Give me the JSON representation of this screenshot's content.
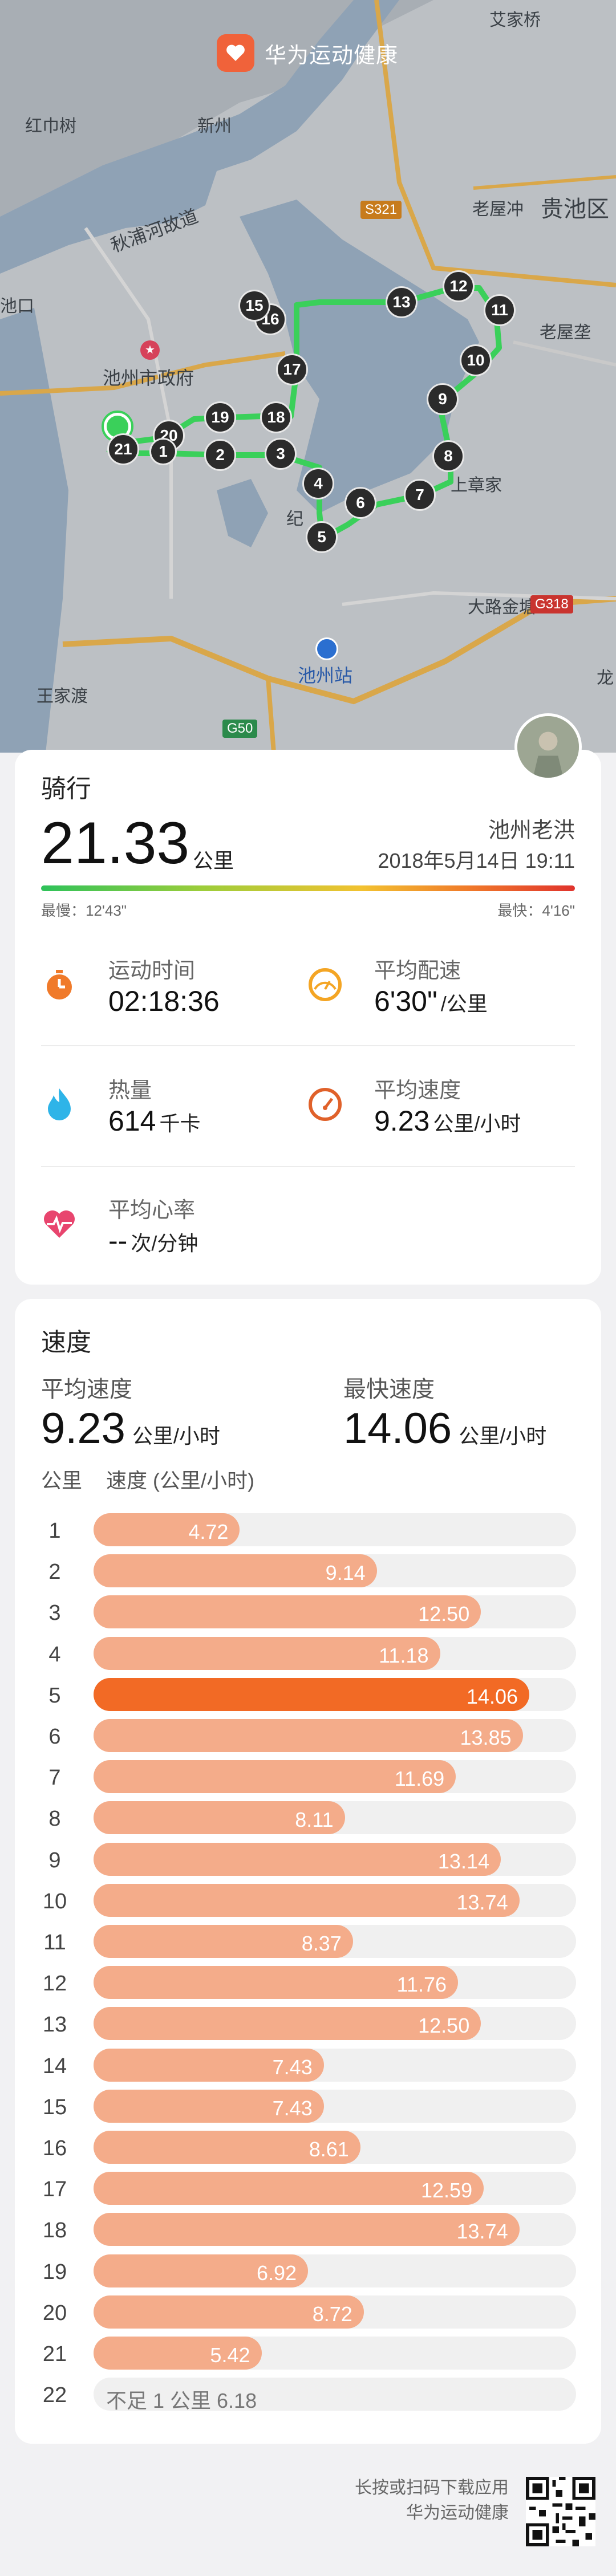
{
  "app": {
    "name": "华为运动健康"
  },
  "map": {
    "places": {
      "aijiaqiao": "艾家桥",
      "hongxunshu": "红巾树",
      "xinzhou": "新州",
      "qiupuhe": "秋浦河故道",
      "s321": "S321",
      "laowuchong": "老屋冲",
      "guichiqu": "贵池区",
      "chizhou_short": "池口",
      "chizhou_gov": "池州市政府",
      "laowuchong2": "老屋垄",
      "lao_zhangjia": "上章家",
      "ji": "纪",
      "dalu_jintang": "大路金塘",
      "g318": "G318",
      "chizhou_station": "池州站",
      "wangjiadu": "王家渡",
      "g50": "G50",
      "long": "龙"
    },
    "route_markers": [
      "21",
      "20",
      "1",
      "19",
      "2",
      "18",
      "3",
      "17",
      "16",
      "15",
      "13",
      "12",
      "11",
      "10",
      "9",
      "8",
      "4",
      "5",
      "6",
      "7"
    ]
  },
  "summary": {
    "sport": "骑行",
    "distance": "21.33",
    "distance_unit": "公里",
    "user": "池州老洪",
    "datetime": "2018年5月14日 19:11",
    "slowest": "最慢：12'43\"",
    "fastest": "最快：4'16\"",
    "metrics": {
      "time": {
        "label": "运动时间",
        "value": "02:18:36",
        "unit": ""
      },
      "pace": {
        "label": "平均配速",
        "value": "6'30\"",
        "unit": "/公里"
      },
      "calories": {
        "label": "热量",
        "value": "614",
        "unit": "千卡"
      },
      "avg_speed": {
        "label": "平均速度",
        "value": "9.23",
        "unit": "公里/小时"
      },
      "heart": {
        "label": "平均心率",
        "value": "--",
        "unit": "次/分钟"
      }
    },
    "icon_names": [
      "stopwatch-icon",
      "pace-gauge-icon",
      "flame-icon",
      "speedometer-icon",
      "heart-rate-icon"
    ],
    "accent_colors": {
      "orange": "#f07a2a",
      "red": "#e0332d",
      "green": "#2ec25a"
    }
  },
  "speed": {
    "title": "速度",
    "avg_label": "平均速度",
    "avg_value": "9.23",
    "avg_unit": "公里/小时",
    "max_label": "最快速度",
    "max_value": "14.06",
    "max_unit": "公里/小时",
    "col_km": "公里",
    "col_speed": "速度 (公里/小时)",
    "rows": [
      {
        "km": "1",
        "speed": 4.72,
        "label": "4.72"
      },
      {
        "km": "2",
        "speed": 9.14,
        "label": "9.14"
      },
      {
        "km": "3",
        "speed": 12.5,
        "label": "12.50"
      },
      {
        "km": "4",
        "speed": 11.18,
        "label": "11.18"
      },
      {
        "km": "5",
        "speed": 14.06,
        "label": "14.06",
        "max": true
      },
      {
        "km": "6",
        "speed": 13.85,
        "label": "13.85"
      },
      {
        "km": "7",
        "speed": 11.69,
        "label": "11.69"
      },
      {
        "km": "8",
        "speed": 8.11,
        "label": "8.11"
      },
      {
        "km": "9",
        "speed": 13.14,
        "label": "13.14"
      },
      {
        "km": "10",
        "speed": 13.74,
        "label": "13.74"
      },
      {
        "km": "11",
        "speed": 8.37,
        "label": "8.37"
      },
      {
        "km": "12",
        "speed": 11.76,
        "label": "11.76"
      },
      {
        "km": "13",
        "speed": 12.5,
        "label": "12.50"
      },
      {
        "km": "14",
        "speed": 7.43,
        "label": "7.43"
      },
      {
        "km": "15",
        "speed": 7.43,
        "label": "7.43"
      },
      {
        "km": "16",
        "speed": 8.61,
        "label": "8.61"
      },
      {
        "km": "17",
        "speed": 12.59,
        "label": "12.59"
      },
      {
        "km": "18",
        "speed": 13.74,
        "label": "13.74"
      },
      {
        "km": "19",
        "speed": 6.92,
        "label": "6.92"
      },
      {
        "km": "20",
        "speed": 8.72,
        "label": "8.72"
      },
      {
        "km": "21",
        "speed": 5.42,
        "label": "5.42"
      }
    ],
    "last_row": {
      "km": "22",
      "note": "不足 1 公里 6.18"
    },
    "fill_color": "#f4ac8a",
    "max_color": "#f26a25"
  },
  "footer": {
    "line1": "长按或扫码下载应用",
    "line2": "华为运动健康"
  }
}
